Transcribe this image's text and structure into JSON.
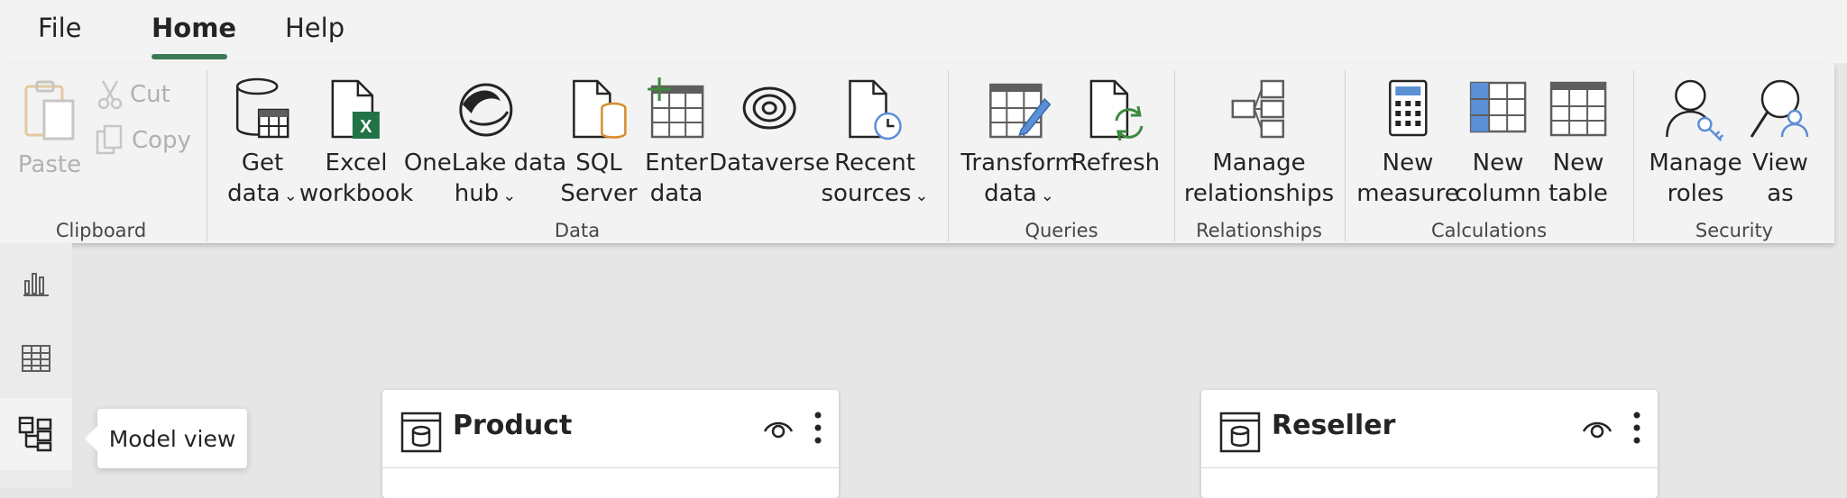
{
  "tabs": [
    {
      "label": "File"
    },
    {
      "label": "Home",
      "active": true
    },
    {
      "label": "Help"
    }
  ],
  "clipboard": {
    "paste": "Paste",
    "cut": "Cut",
    "copy": "Copy",
    "group": "Clipboard"
  },
  "data_group": {
    "get_data": [
      "Get",
      "data"
    ],
    "excel": [
      "Excel",
      "workbook"
    ],
    "onelake": [
      "OneLake data",
      "hub"
    ],
    "sql": [
      "SQL",
      "Server"
    ],
    "enter": [
      "Enter",
      "data"
    ],
    "dataverse": "Dataverse",
    "recent": [
      "Recent",
      "sources"
    ],
    "group": "Data"
  },
  "queries": {
    "transform": [
      "Transform",
      "data"
    ],
    "refresh": "Refresh",
    "group": "Queries"
  },
  "relationships": {
    "manage": [
      "Manage",
      "relationships"
    ],
    "group": "Relationships"
  },
  "calculations": {
    "new_measure": [
      "New",
      "measure"
    ],
    "new_column": [
      "New",
      "column"
    ],
    "new_table": [
      "New",
      "table"
    ],
    "group": "Calculations"
  },
  "security": {
    "manage_roles": [
      "Manage",
      "roles"
    ],
    "view_as": [
      "View",
      "as"
    ],
    "group": "Security"
  },
  "rail": {
    "items": [
      {
        "icon": "report-view-icon"
      },
      {
        "icon": "table-view-icon"
      },
      {
        "icon": "model-view-icon",
        "active": true
      }
    ],
    "tooltip": "Model view"
  },
  "cards": [
    {
      "title": "Product"
    },
    {
      "title": "Reseller"
    }
  ],
  "colors": {
    "accent": "#3b7a57",
    "excel_green": "#217346",
    "sql_orange": "#d68d2a",
    "blue": "#5b8fd6"
  }
}
